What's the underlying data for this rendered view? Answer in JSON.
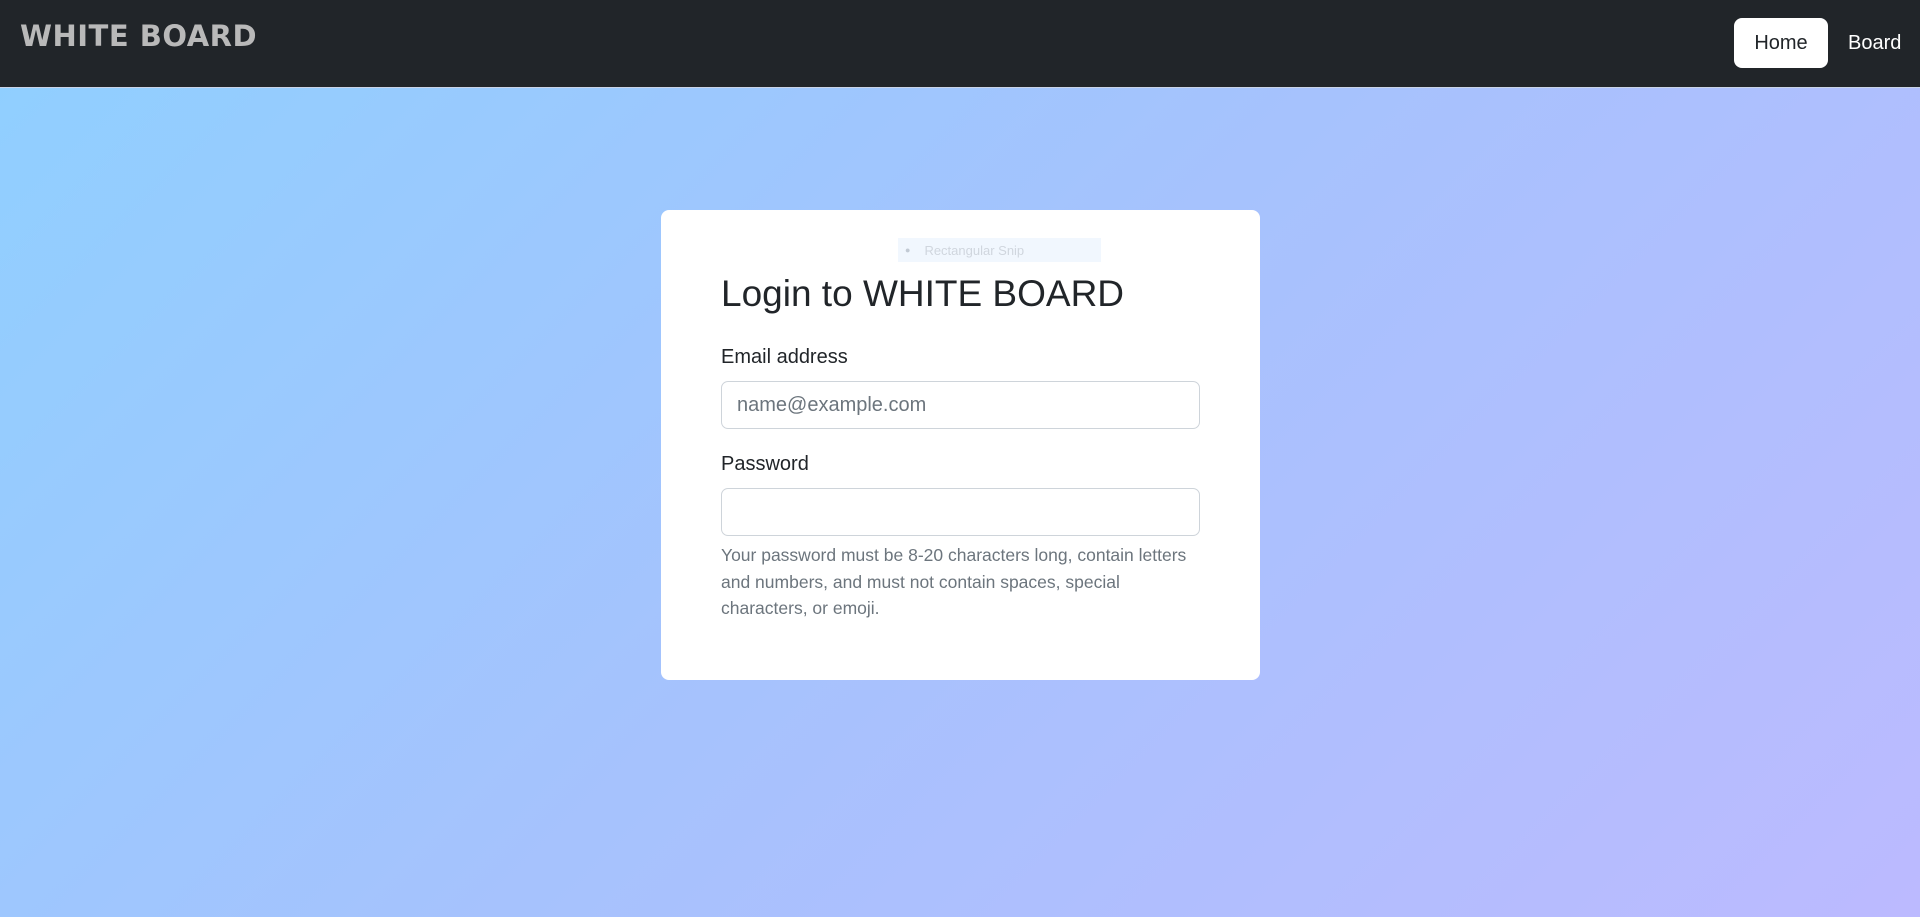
{
  "navbar": {
    "brand": "WHITE BOARD",
    "links": [
      {
        "label": "Home",
        "active": true
      },
      {
        "label": "Board",
        "active": false
      }
    ]
  },
  "overlay": {
    "snip_label": "Rectangular Snip",
    "snip_icon": "snip-icon"
  },
  "login": {
    "title": "Login to WHITE BOARD",
    "email_label": "Email address",
    "email_placeholder": "name@example.com",
    "email_value": "",
    "password_label": "Password",
    "password_value": "",
    "password_help": "Your password must be 8-20 characters long, contain letters and numbers, and must not contain spaces, special characters, or emoji."
  },
  "colors": {
    "navbar_bg": "#212529",
    "gradient_start": "#8fd0ff",
    "gradient_end": "#bcbaff",
    "card_bg": "#ffffff"
  }
}
